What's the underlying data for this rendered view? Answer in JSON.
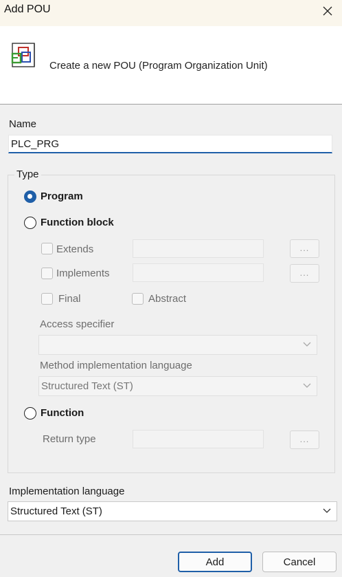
{
  "window": {
    "title": "Add POU",
    "close_icon": "close-icon"
  },
  "header": {
    "description": "Create a new POU (Program Organization Unit)",
    "icon": "pou-icon"
  },
  "name": {
    "label": "Name",
    "value": "PLC_PRG"
  },
  "type": {
    "group_label": "Type",
    "selected": "Program",
    "program": {
      "label": "Program",
      "checked": true
    },
    "function_block": {
      "label": "Function block",
      "checked": false,
      "extends_label": "Extends",
      "implements_label": "Implements",
      "final_label": "Final",
      "abstract_label": "Abstract",
      "browse_label": "...",
      "access_specifier_label": "Access specifier",
      "access_specifier_value": "",
      "method_impl_label": "Method implementation language",
      "method_impl_value": "Structured Text (ST)"
    },
    "function": {
      "label": "Function",
      "checked": false,
      "return_type_label": "Return type",
      "browse_label": "..."
    }
  },
  "implementation_language": {
    "label": "Implementation language",
    "value": "Structured Text (ST)"
  },
  "buttons": {
    "add": "Add",
    "cancel": "Cancel"
  },
  "colors": {
    "accent": "#1f5fa8",
    "titlebar_bg": "#faf6ec",
    "dialog_bg": "#f0f0f0"
  }
}
